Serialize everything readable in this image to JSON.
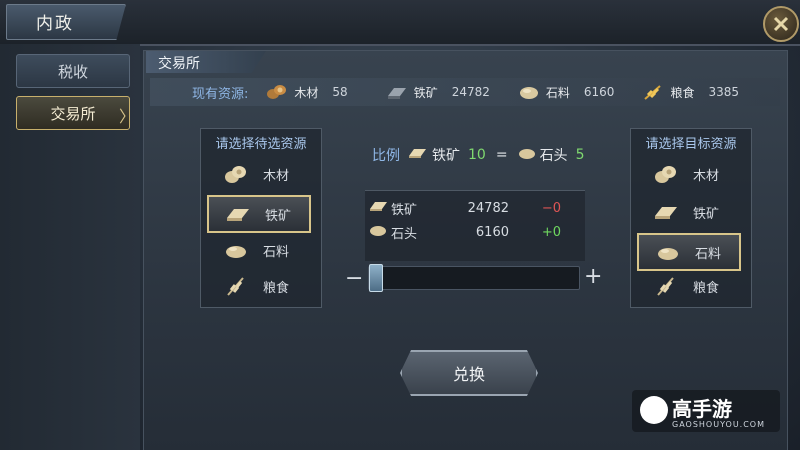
{
  "window": {
    "title": "内政"
  },
  "nav": {
    "items": [
      {
        "label": "税收"
      },
      {
        "label": "交易所",
        "arrow": "〉"
      }
    ]
  },
  "section": {
    "title": "交易所"
  },
  "resources": {
    "label": "现有资源:",
    "items": [
      {
        "name": "木材",
        "value": "58",
        "icon": "wood-icon"
      },
      {
        "name": "铁矿",
        "value": "24782",
        "icon": "iron-ore-icon"
      },
      {
        "name": "石料",
        "value": "6160",
        "icon": "stone-icon"
      },
      {
        "name": "粮食",
        "value": "3385",
        "icon": "grain-icon"
      }
    ]
  },
  "source_list": {
    "header": "请选择待选资源",
    "options": [
      {
        "label": "木材",
        "icon": "wood-icon"
      },
      {
        "label": "铁矿",
        "icon": "iron-ore-icon",
        "selected": true
      },
      {
        "label": "石料",
        "icon": "stone-icon"
      },
      {
        "label": "粮食",
        "icon": "grain-icon"
      }
    ]
  },
  "target_list": {
    "header": "请选择目标资源",
    "options": [
      {
        "label": "木材",
        "icon": "wood-icon"
      },
      {
        "label": "铁矿",
        "icon": "iron-ore-icon"
      },
      {
        "label": "石料",
        "icon": "stone-icon",
        "selected": true
      },
      {
        "label": "粮食",
        "icon": "grain-icon"
      }
    ]
  },
  "ratio": {
    "label": "比例",
    "from_name": "铁矿",
    "from_value": "10",
    "equals": "=",
    "to_name": "石头",
    "to_value": "5"
  },
  "detail": {
    "rows": [
      {
        "name": "铁矿",
        "value": "24782",
        "delta": "−0",
        "delta_color": "#e05555"
      },
      {
        "name": "石头",
        "value": "6160",
        "delta": "+0",
        "delta_color": "#6fd85f"
      }
    ]
  },
  "slider": {
    "minus": "−",
    "plus": "+",
    "level": 0
  },
  "exchange_button": {
    "label": "兑换"
  },
  "watermark": {
    "name": "高手游",
    "url": "GAOSHOUYOU.COM"
  },
  "colors": {
    "accent_gold": "#d8c58a",
    "label_blue": "#8fb7e6",
    "positive": "#6fd85f",
    "negative": "#e05555"
  }
}
